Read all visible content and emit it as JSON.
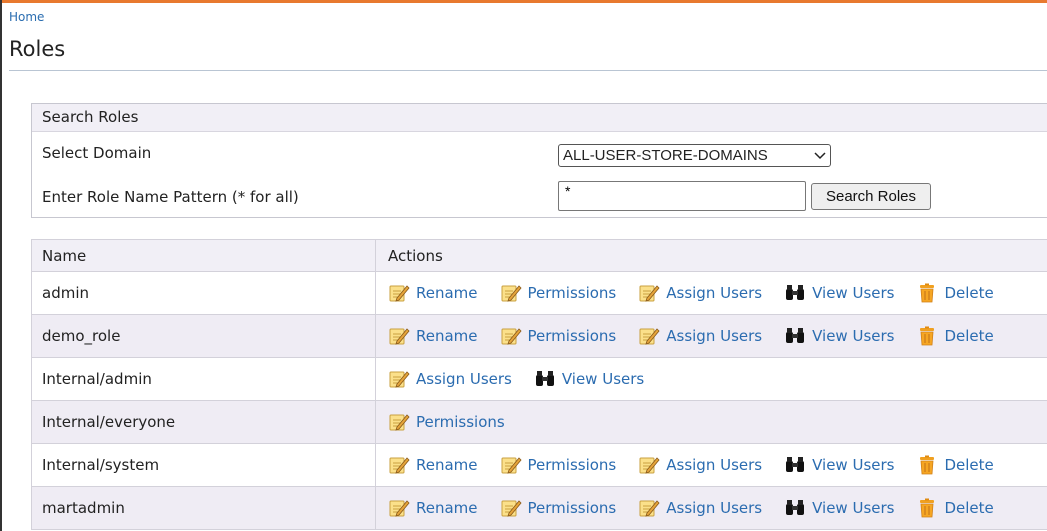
{
  "breadcrumb": "Home",
  "page_title": "Roles",
  "search": {
    "header": "Search Roles",
    "domain_label": "Select Domain",
    "domain_value": "ALL-USER-STORE-DOMAINS",
    "pattern_label": "Enter Role Name Pattern (* for all)",
    "pattern_value": "*",
    "button_label": "Search Roles"
  },
  "table": {
    "columns": [
      "Name",
      "Actions"
    ],
    "rows": [
      {
        "name": "admin",
        "actions": [
          "Rename",
          "Permissions",
          "Assign Users",
          "View Users",
          "Delete"
        ]
      },
      {
        "name": "demo_role",
        "actions": [
          "Rename",
          "Permissions",
          "Assign Users",
          "View Users",
          "Delete"
        ]
      },
      {
        "name": "Internal/admin",
        "actions": [
          "Assign Users",
          "View Users"
        ]
      },
      {
        "name": "Internal/everyone",
        "actions": [
          "Permissions"
        ]
      },
      {
        "name": "Internal/system",
        "actions": [
          "Rename",
          "Permissions",
          "Assign Users",
          "View Users",
          "Delete"
        ]
      },
      {
        "name": "martadmin",
        "actions": [
          "Rename",
          "Permissions",
          "Assign Users",
          "View Users",
          "Delete"
        ]
      }
    ]
  },
  "icons": {
    "Rename": "edit-icon",
    "Permissions": "edit-icon",
    "Assign Users": "edit-icon",
    "View Users": "binoculars-icon",
    "Delete": "trash-icon"
  },
  "colors": {
    "accent_bar": "#e8792f",
    "link": "#2b6cb0",
    "header_bg": "#f1eff6",
    "alt_row_bg": "#efecf4"
  }
}
